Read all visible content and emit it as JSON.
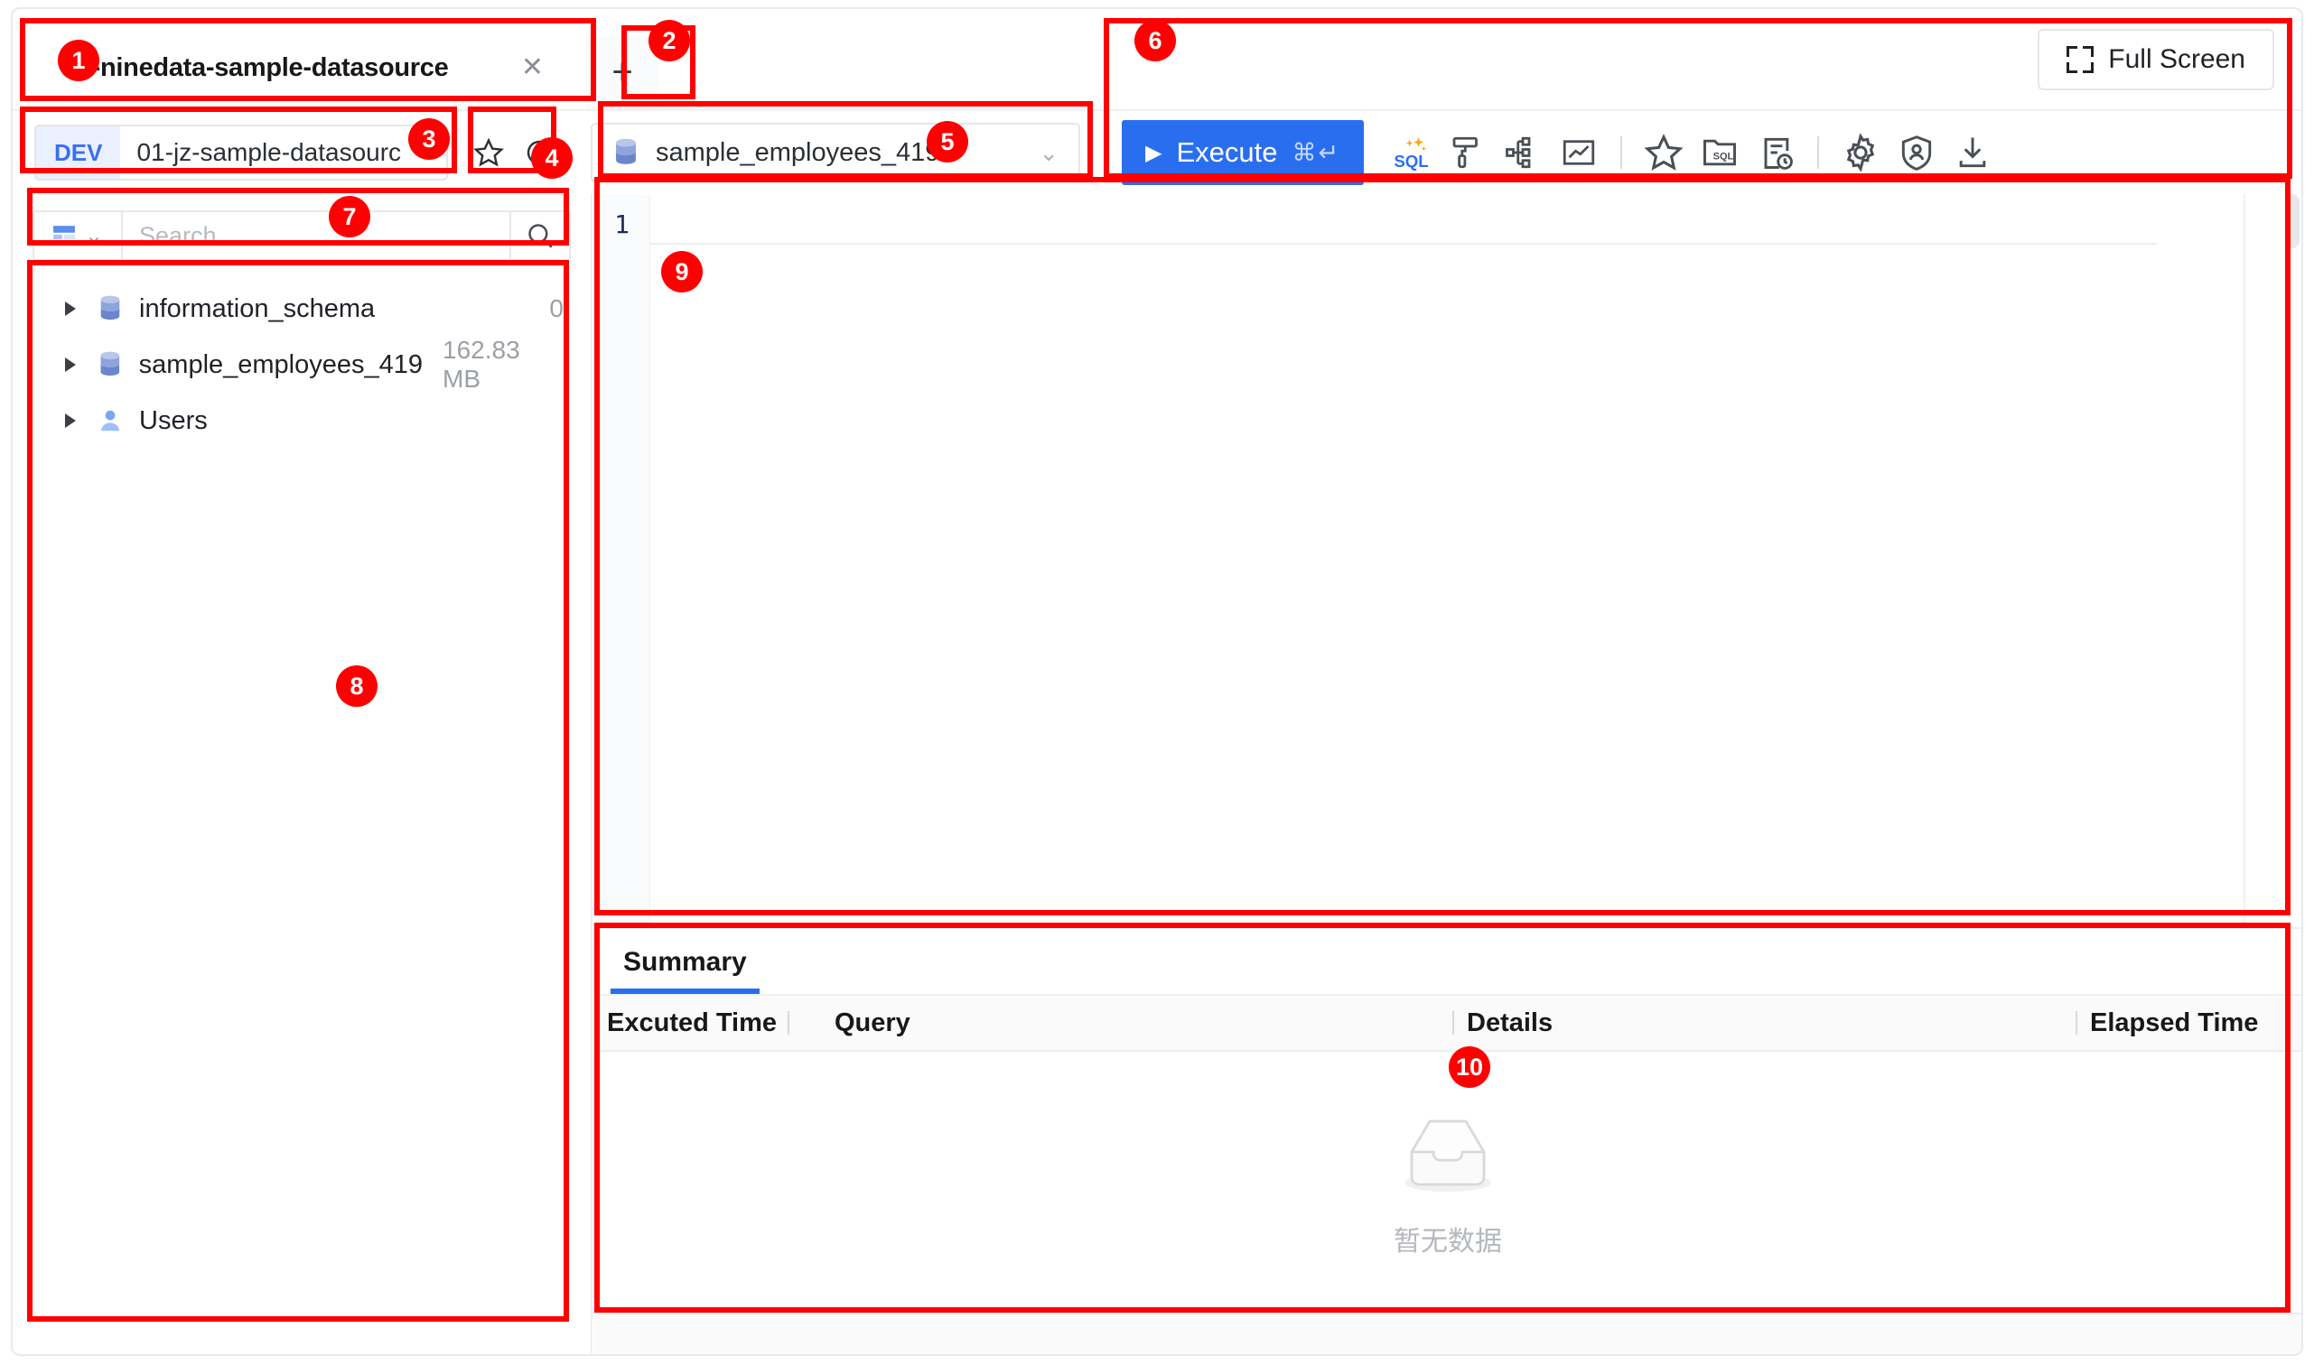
{
  "window": {
    "app": "NineData SQL Console"
  },
  "tabs": {
    "items": [
      {
        "label": "01-ninedata-sample-datasource",
        "close_icon": "close-icon",
        "active": true
      }
    ],
    "new_tab_icon": "plus-icon"
  },
  "header": {
    "fullscreen_label": "Full Screen",
    "fullscreen_icon": "fullscreen-icon"
  },
  "connection": {
    "env_label": "DEV",
    "datasource_name": "01-jz-sample-datasourc",
    "favorite_icon": "star-icon",
    "refresh_icon": "refresh-icon",
    "database_name": "sample_employees_419",
    "database_icon": "database-icon",
    "dropdown_icon": "chevron-down-icon"
  },
  "toolbar": {
    "execute_label": "Execute",
    "execute_play_icon": "play-icon",
    "execute_shortcut": "⌘↵",
    "icons": [
      {
        "name": "ai-sql-icon",
        "title": "SQL"
      },
      {
        "name": "format-sql-icon",
        "title": "Format"
      },
      {
        "name": "flowchart-icon",
        "title": "Flow"
      },
      {
        "name": "chart-icon",
        "title": "Chart"
      },
      {
        "name": "separator",
        "title": ""
      },
      {
        "name": "favorite-star-icon",
        "title": "Favorite"
      },
      {
        "name": "sql-folder-icon",
        "title": "SQL Folder"
      },
      {
        "name": "history-clock-icon",
        "title": "History"
      },
      {
        "name": "separator",
        "title": ""
      },
      {
        "name": "settings-gear-icon",
        "title": "Settings"
      },
      {
        "name": "security-shield-icon",
        "title": "Security"
      },
      {
        "name": "download-icon",
        "title": "Download"
      }
    ]
  },
  "search": {
    "placeholder": "Search",
    "value": "",
    "type_icon": "grid-icon",
    "type_caret_icon": "chevron-down-icon",
    "search_icon": "search-icon"
  },
  "tree": {
    "items": [
      {
        "label": "information_schema",
        "meta": "0",
        "meta_position": "right",
        "icon": "database-icon",
        "expander": "chevron-right-icon"
      },
      {
        "label": "sample_employees_419",
        "meta": "162.83 MB",
        "meta_position": "inline",
        "icon": "database-icon",
        "expander": "chevron-right-icon"
      },
      {
        "label": "Users",
        "meta": "",
        "meta_position": "none",
        "icon": "user-icon",
        "expander": "chevron-right-icon"
      }
    ]
  },
  "editor": {
    "line_numbers": [
      "1"
    ],
    "content": ""
  },
  "results": {
    "tabs": [
      {
        "label": "Summary",
        "active": true
      }
    ],
    "columns": [
      "Excuted Time",
      "Query",
      "Details",
      "Elapsed Time"
    ],
    "rows": [],
    "empty_text": "暂无数据",
    "empty_icon": "empty-box-icon"
  },
  "annotations": {
    "color": "#ff0000",
    "markers": [
      {
        "id": "1",
        "target": "tab-bar"
      },
      {
        "id": "2",
        "target": "new-tab-button"
      },
      {
        "id": "3",
        "target": "datasource-select"
      },
      {
        "id": "4",
        "target": "connection-actions"
      },
      {
        "id": "5",
        "target": "database-select"
      },
      {
        "id": "6",
        "target": "toolbar-region"
      },
      {
        "id": "7",
        "target": "search-bar"
      },
      {
        "id": "8",
        "target": "object-tree"
      },
      {
        "id": "9",
        "target": "sql-editor"
      },
      {
        "id": "10",
        "target": "results-panel"
      }
    ]
  }
}
